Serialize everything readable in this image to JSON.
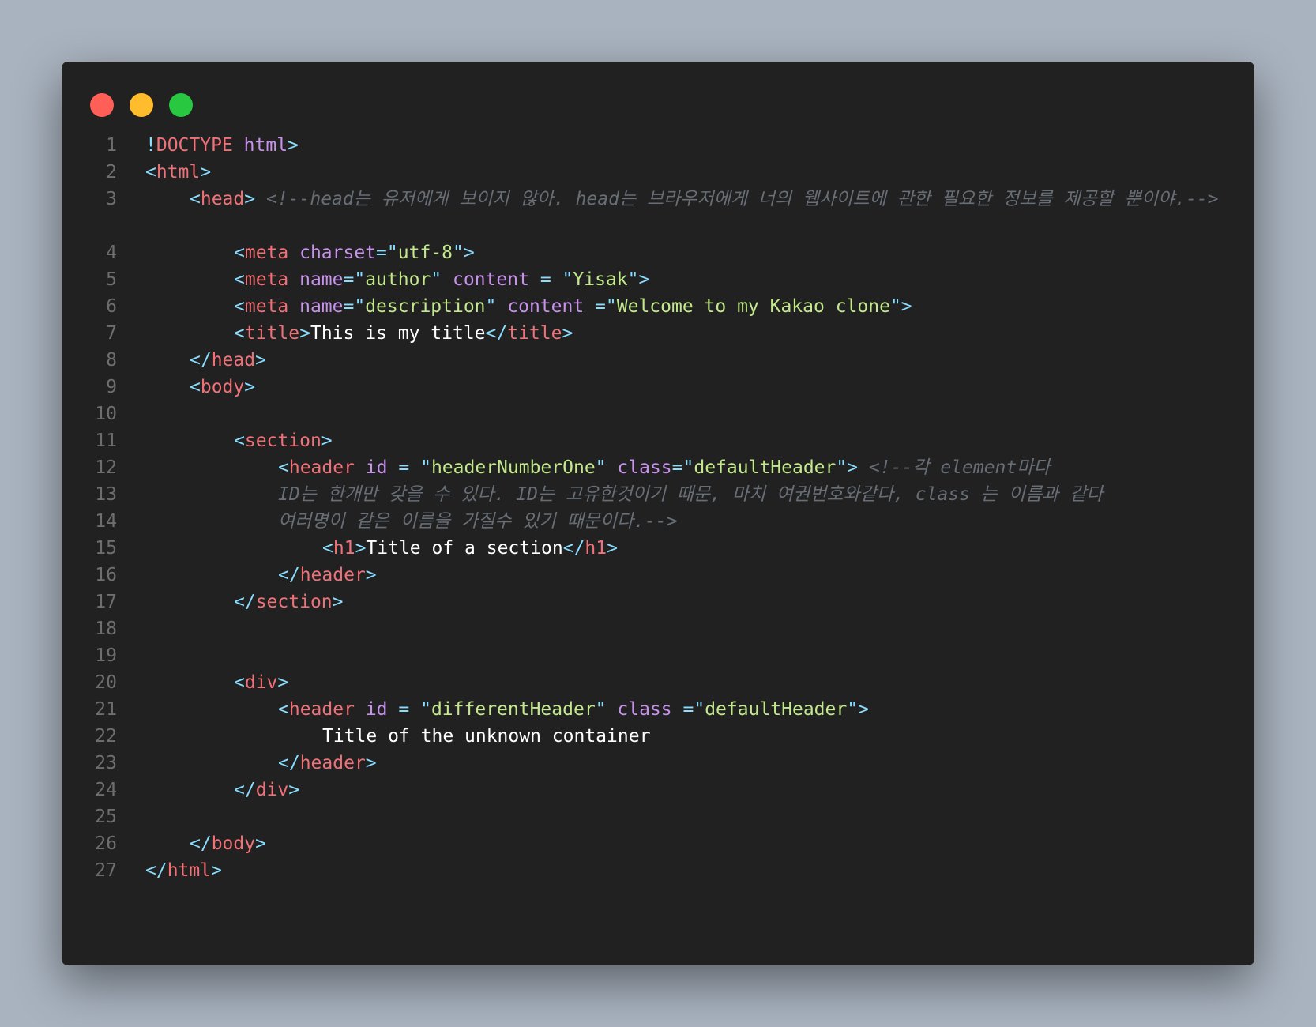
{
  "window": {
    "controls": [
      {
        "name": "close",
        "color": "#ff5f57"
      },
      {
        "name": "minimize",
        "color": "#ffbd2e"
      },
      {
        "name": "maximize",
        "color": "#28c840"
      }
    ]
  },
  "theme": {
    "background": "#212121",
    "punct": "#89ddff",
    "tag": "#f07178",
    "attr": "#c792ea",
    "string": "#c3e88d",
    "text": "#ffffff",
    "comment": "#676e76",
    "line_number": "#6e6e6e"
  },
  "code_lines": [
    {
      "num": "1",
      "indent": 0,
      "tokens": [
        [
          "punct",
          "!"
        ],
        [
          "tag",
          "DOCTYPE"
        ],
        [
          "text",
          " "
        ],
        [
          "attr",
          "html"
        ],
        [
          "punct",
          ">"
        ]
      ]
    },
    {
      "num": "2",
      "indent": 0,
      "tokens": [
        [
          "punct",
          "<"
        ],
        [
          "tag",
          "html"
        ],
        [
          "punct",
          ">"
        ]
      ]
    },
    {
      "num": "3",
      "indent": 1,
      "tokens": [
        [
          "punct",
          "<"
        ],
        [
          "tag",
          "head"
        ],
        [
          "punct",
          ">"
        ],
        [
          "text",
          " "
        ],
        [
          "comment",
          "<!--head는 유저에게 보이지 않아. head는 브라우저에게 너의 웹사이트에 관한 필요한 정보를 제공할 뿐이야.-->"
        ]
      ]
    },
    {
      "num": "4",
      "indent": 2,
      "tokens": [
        [
          "punct",
          "<"
        ],
        [
          "tag",
          "meta"
        ],
        [
          "text",
          " "
        ],
        [
          "attr",
          "charset"
        ],
        [
          "punct",
          "=\""
        ],
        [
          "str",
          "utf-8"
        ],
        [
          "punct",
          "\">"
        ]
      ]
    },
    {
      "num": "5",
      "indent": 2,
      "tokens": [
        [
          "punct",
          "<"
        ],
        [
          "tag",
          "meta"
        ],
        [
          "text",
          " "
        ],
        [
          "attr",
          "name"
        ],
        [
          "punct",
          "=\""
        ],
        [
          "str",
          "author"
        ],
        [
          "punct",
          "\""
        ],
        [
          "text",
          " "
        ],
        [
          "attr",
          "content"
        ],
        [
          "text",
          " "
        ],
        [
          "punct",
          "="
        ],
        [
          "text",
          " "
        ],
        [
          "punct",
          "\""
        ],
        [
          "str",
          "Yisak"
        ],
        [
          "punct",
          "\">"
        ]
      ]
    },
    {
      "num": "6",
      "indent": 2,
      "tokens": [
        [
          "punct",
          "<"
        ],
        [
          "tag",
          "meta"
        ],
        [
          "text",
          " "
        ],
        [
          "attr",
          "name"
        ],
        [
          "punct",
          "=\""
        ],
        [
          "str",
          "description"
        ],
        [
          "punct",
          "\""
        ],
        [
          "text",
          " "
        ],
        [
          "attr",
          "content"
        ],
        [
          "text",
          " "
        ],
        [
          "punct",
          "=\""
        ],
        [
          "str",
          "Welcome to my Kakao clone"
        ],
        [
          "punct",
          "\">"
        ]
      ]
    },
    {
      "num": "7",
      "indent": 2,
      "tokens": [
        [
          "punct",
          "<"
        ],
        [
          "tag",
          "title"
        ],
        [
          "punct",
          ">"
        ],
        [
          "text",
          "This is my title"
        ],
        [
          "punct",
          "</"
        ],
        [
          "tag",
          "title"
        ],
        [
          "punct",
          ">"
        ]
      ]
    },
    {
      "num": "8",
      "indent": 1,
      "tokens": [
        [
          "punct",
          "</"
        ],
        [
          "tag",
          "head"
        ],
        [
          "punct",
          ">"
        ]
      ]
    },
    {
      "num": "9",
      "indent": 1,
      "tokens": [
        [
          "punct",
          "<"
        ],
        [
          "tag",
          "body"
        ],
        [
          "punct",
          ">"
        ]
      ]
    },
    {
      "num": "10",
      "indent": 0,
      "tokens": []
    },
    {
      "num": "11",
      "indent": 2,
      "tokens": [
        [
          "punct",
          "<"
        ],
        [
          "tag",
          "section"
        ],
        [
          "punct",
          ">"
        ]
      ]
    },
    {
      "num": "12",
      "indent": 3,
      "tokens": [
        [
          "punct",
          "<"
        ],
        [
          "tag",
          "header"
        ],
        [
          "text",
          " "
        ],
        [
          "attr",
          "id"
        ],
        [
          "text",
          " "
        ],
        [
          "punct",
          "="
        ],
        [
          "text",
          " "
        ],
        [
          "punct",
          "\""
        ],
        [
          "str",
          "headerNumberOne"
        ],
        [
          "punct",
          "\""
        ],
        [
          "text",
          " "
        ],
        [
          "attr",
          "class"
        ],
        [
          "punct",
          "=\""
        ],
        [
          "str",
          "defaultHeader"
        ],
        [
          "punct",
          "\">"
        ],
        [
          "text",
          " "
        ],
        [
          "comment",
          "<!--각 element마다"
        ]
      ]
    },
    {
      "num": "13",
      "indent": 3,
      "tokens": [
        [
          "comment",
          "ID는 한개만 갖을 수 있다. ID는 고유한것이기 때문, 마치 여권번호와같다, class 는 이름과 같다"
        ]
      ]
    },
    {
      "num": "14",
      "indent": 3,
      "tokens": [
        [
          "comment",
          "여러명이 같은 이름을 가질수 있기 때문이다.-->"
        ]
      ]
    },
    {
      "num": "15",
      "indent": 4,
      "tokens": [
        [
          "punct",
          "<"
        ],
        [
          "tag",
          "h1"
        ],
        [
          "punct",
          ">"
        ],
        [
          "text",
          "Title of a section"
        ],
        [
          "punct",
          "</"
        ],
        [
          "tag",
          "h1"
        ],
        [
          "punct",
          ">"
        ]
      ]
    },
    {
      "num": "16",
      "indent": 3,
      "tokens": [
        [
          "punct",
          "</"
        ],
        [
          "tag",
          "header"
        ],
        [
          "punct",
          ">"
        ]
      ]
    },
    {
      "num": "17",
      "indent": 2,
      "tokens": [
        [
          "punct",
          "</"
        ],
        [
          "tag",
          "section"
        ],
        [
          "punct",
          ">"
        ]
      ]
    },
    {
      "num": "18",
      "indent": 0,
      "tokens": []
    },
    {
      "num": "19",
      "indent": 0,
      "tokens": []
    },
    {
      "num": "20",
      "indent": 2,
      "tokens": [
        [
          "punct",
          "<"
        ],
        [
          "tag",
          "div"
        ],
        [
          "punct",
          ">"
        ]
      ]
    },
    {
      "num": "21",
      "indent": 3,
      "tokens": [
        [
          "punct",
          "<"
        ],
        [
          "tag",
          "header"
        ],
        [
          "text",
          " "
        ],
        [
          "attr",
          "id"
        ],
        [
          "text",
          " "
        ],
        [
          "punct",
          "="
        ],
        [
          "text",
          " "
        ],
        [
          "punct",
          "\""
        ],
        [
          "str",
          "differentHeader"
        ],
        [
          "punct",
          "\""
        ],
        [
          "text",
          " "
        ],
        [
          "attr",
          "class"
        ],
        [
          "text",
          " "
        ],
        [
          "punct",
          "=\""
        ],
        [
          "str",
          "defaultHeader"
        ],
        [
          "punct",
          "\">"
        ]
      ]
    },
    {
      "num": "22",
      "indent": 4,
      "tokens": [
        [
          "text",
          "Title of the unknown container"
        ]
      ]
    },
    {
      "num": "23",
      "indent": 3,
      "tokens": [
        [
          "punct",
          "</"
        ],
        [
          "tag",
          "header"
        ],
        [
          "punct",
          ">"
        ]
      ]
    },
    {
      "num": "24",
      "indent": 2,
      "tokens": [
        [
          "punct",
          "</"
        ],
        [
          "tag",
          "div"
        ],
        [
          "punct",
          ">"
        ]
      ]
    },
    {
      "num": "25",
      "indent": 0,
      "tokens": []
    },
    {
      "num": "26",
      "indent": 1,
      "tokens": [
        [
          "punct",
          "</"
        ],
        [
          "tag",
          "body"
        ],
        [
          "punct",
          ">"
        ]
      ]
    },
    {
      "num": "27",
      "indent": 0,
      "tokens": [
        [
          "punct",
          "</"
        ],
        [
          "tag",
          "html"
        ],
        [
          "punct",
          ">"
        ]
      ]
    }
  ]
}
